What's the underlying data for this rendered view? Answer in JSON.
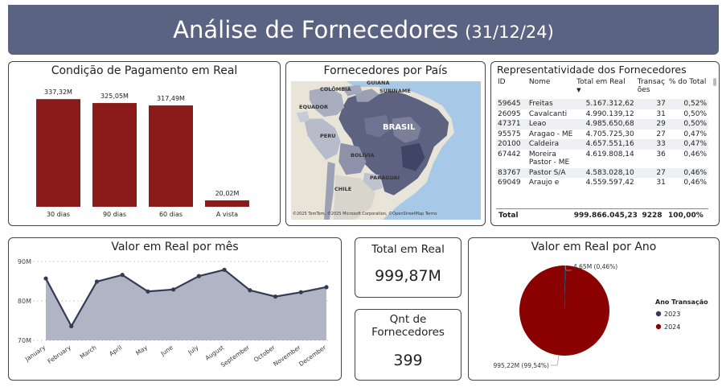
{
  "header": {
    "title": "Análise de Fornecedores",
    "date": "(31/12/24)"
  },
  "payment": {
    "title": "Condição de Pagamento em Real",
    "chart_data": {
      "type": "bar",
      "categories": [
        "30 dias",
        "90 dias",
        "60 dias",
        "A vista"
      ],
      "values": [
        337.32,
        325.05,
        317.49,
        20.02
      ],
      "labels": [
        "337,32M",
        "325,05M",
        "317,49M",
        "20,02M"
      ],
      "unit": "M",
      "color": "#8b1a1a"
    }
  },
  "map": {
    "title": "Fornecedores por País",
    "labels": [
      "GUIANA",
      "COLÔMBIA",
      "SURINAME",
      "EQUADOR",
      "PERU",
      "BRASIL",
      "BOLÍVIA",
      "PARAGUAI",
      "CHILE"
    ],
    "attribution": "©2025 TomTom, ©2025 Microsoft Corporation, ©OpenStreetMap  Terms"
  },
  "suppliers": {
    "title": "Representatividade dos Fornecedores",
    "columns": [
      "ID",
      "Nome",
      "Total em Real",
      "Transações",
      "% do Total"
    ],
    "col_transacoes_lines": [
      "Transaç",
      "ões"
    ],
    "rows": [
      {
        "id": "59645",
        "nome": "Freitas",
        "total": "5.167.312,62",
        "trans": "37",
        "pct": "0,52%"
      },
      {
        "id": "26095",
        "nome": "Cavalcanti",
        "total": "4.990.139,12",
        "trans": "31",
        "pct": "0,50%"
      },
      {
        "id": "47371",
        "nome": "Leao",
        "total": "4.985.650,68",
        "trans": "29",
        "pct": "0,50%"
      },
      {
        "id": "95575",
        "nome": "Aragao - ME",
        "total": "4.705.725,30",
        "trans": "27",
        "pct": "0,47%"
      },
      {
        "id": "20100",
        "nome": "Caldeira",
        "total": "4.657.551,16",
        "trans": "33",
        "pct": "0,47%"
      },
      {
        "id": "67442",
        "nome": "Moreira Pastor - ME",
        "total": "4.619.808,14",
        "trans": "36",
        "pct": "0,46%"
      },
      {
        "id": "83767",
        "nome": "Pastor S/A",
        "total": "4.583.028,10",
        "trans": "27",
        "pct": "0,46%"
      },
      {
        "id": "69049",
        "nome": "Araujo e",
        "total": "4.559.597,42",
        "trans": "31",
        "pct": "0,46%"
      }
    ],
    "total": {
      "label": "Total",
      "total": "999.866.045,23",
      "trans": "9228",
      "pct": "100,00%"
    }
  },
  "monthly": {
    "title": "Valor em Real por mês",
    "chart_data": {
      "type": "area",
      "categories": [
        "January",
        "February",
        "March",
        "April",
        "May",
        "June",
        "July",
        "August",
        "September",
        "October",
        "November",
        "December"
      ],
      "values": [
        85.7,
        73.6,
        84.9,
        86.6,
        82.4,
        82.9,
        86.3,
        87.9,
        82.7,
        81.1,
        82.2,
        83.5
      ],
      "ylim": [
        70,
        90
      ],
      "yticks": [
        70,
        80,
        90
      ],
      "ytick_labels": [
        "70M",
        "80M",
        "90M"
      ],
      "line_color": "#343b54",
      "fill_color": "#b1b4c4"
    }
  },
  "kpi_total": {
    "label": "Total em Real",
    "value": "999,87M"
  },
  "kpi_count": {
    "label_line1": "Qnt de",
    "label_line2": "Fornecedores",
    "value": "399"
  },
  "yearly": {
    "title": "Valor em Real por Ano",
    "chart_data": {
      "type": "pie",
      "series": [
        {
          "name": "2023",
          "value": 4.65,
          "label": "4,65M (0,46%)",
          "color": "#343b54"
        },
        {
          "name": "2024",
          "value": 995.22,
          "label": "995,22M (99,54%)",
          "color": "#8b0000"
        }
      ],
      "legend_title": "Ano Transação",
      "legend_position": "right"
    }
  }
}
